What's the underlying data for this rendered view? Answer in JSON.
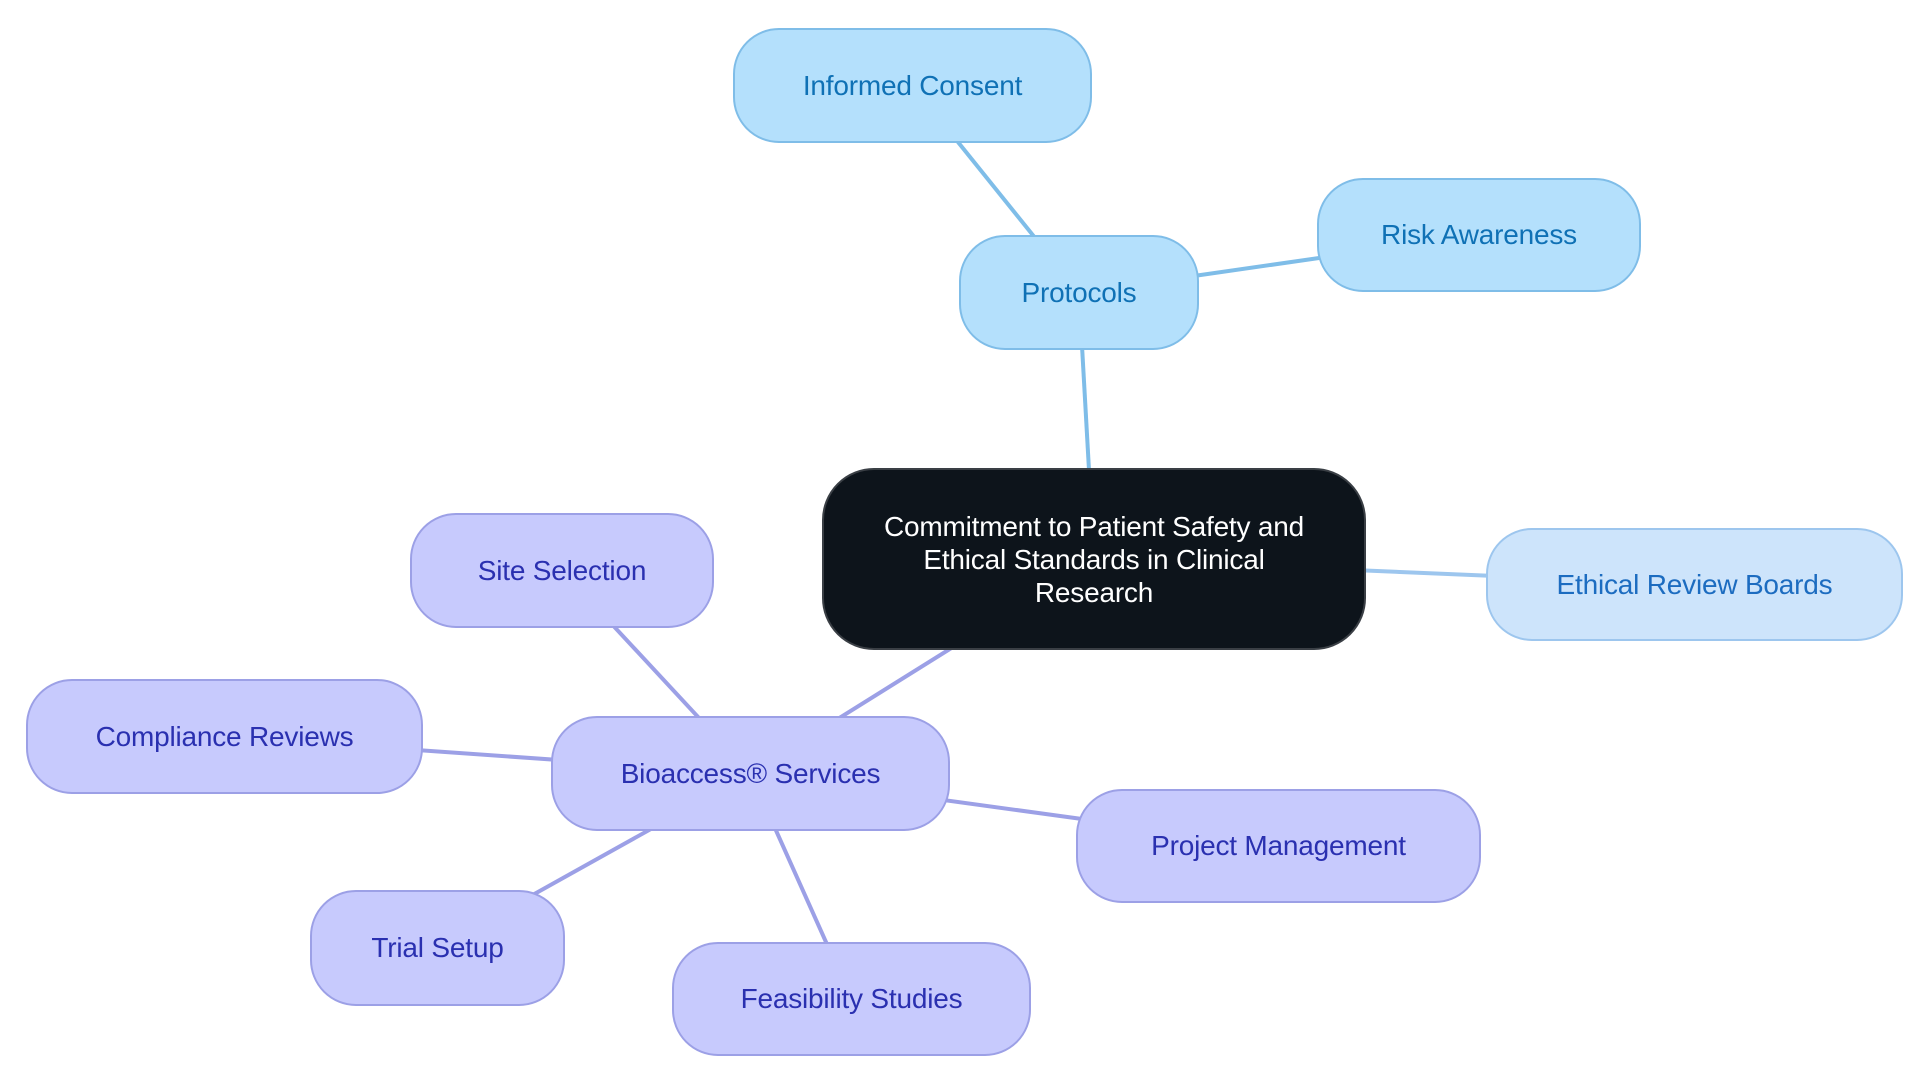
{
  "diagram": {
    "type": "mind-map",
    "root": {
      "id": "root",
      "label": "Commitment to Patient Safety and Ethical Standards in Clinical Research"
    },
    "nodes": [
      {
        "id": "protocols",
        "label": "Protocols",
        "parent": "root",
        "style": "blue"
      },
      {
        "id": "informed-consent",
        "label": "Informed Consent",
        "parent": "protocols",
        "style": "blue"
      },
      {
        "id": "risk-awareness",
        "label": "Risk Awareness",
        "parent": "protocols",
        "style": "blue"
      },
      {
        "id": "ethical-review-boards",
        "label": "Ethical Review Boards",
        "parent": "root",
        "style": "lightblue"
      },
      {
        "id": "bioaccess-services",
        "label": "Bioaccess® Services",
        "parent": "root",
        "style": "purple"
      },
      {
        "id": "site-selection",
        "label": "Site Selection",
        "parent": "bioaccess-services",
        "style": "purple"
      },
      {
        "id": "compliance-reviews",
        "label": "Compliance Reviews",
        "parent": "bioaccess-services",
        "style": "purple"
      },
      {
        "id": "project-management",
        "label": "Project Management",
        "parent": "bioaccess-services",
        "style": "purple"
      },
      {
        "id": "trial-setup",
        "label": "Trial Setup",
        "parent": "bioaccess-services",
        "style": "purple"
      },
      {
        "id": "feasibility-studies",
        "label": "Feasibility Studies",
        "parent": "bioaccess-services",
        "style": "purple"
      }
    ],
    "colors": {
      "root_fill": "#0d141b",
      "root_text": "#ffffff",
      "blue_fill": "#b4e0fc",
      "blue_edge": "#7fbde8",
      "blue_text": "#0f71b5",
      "lightblue_fill": "#cde4fb",
      "lightblue_edge": "#9dc6ee",
      "lightblue_text": "#1c6cc0",
      "purple_fill": "#c7cafd",
      "purple_edge": "#9ca0e6",
      "purple_text": "#2a30b0"
    }
  }
}
